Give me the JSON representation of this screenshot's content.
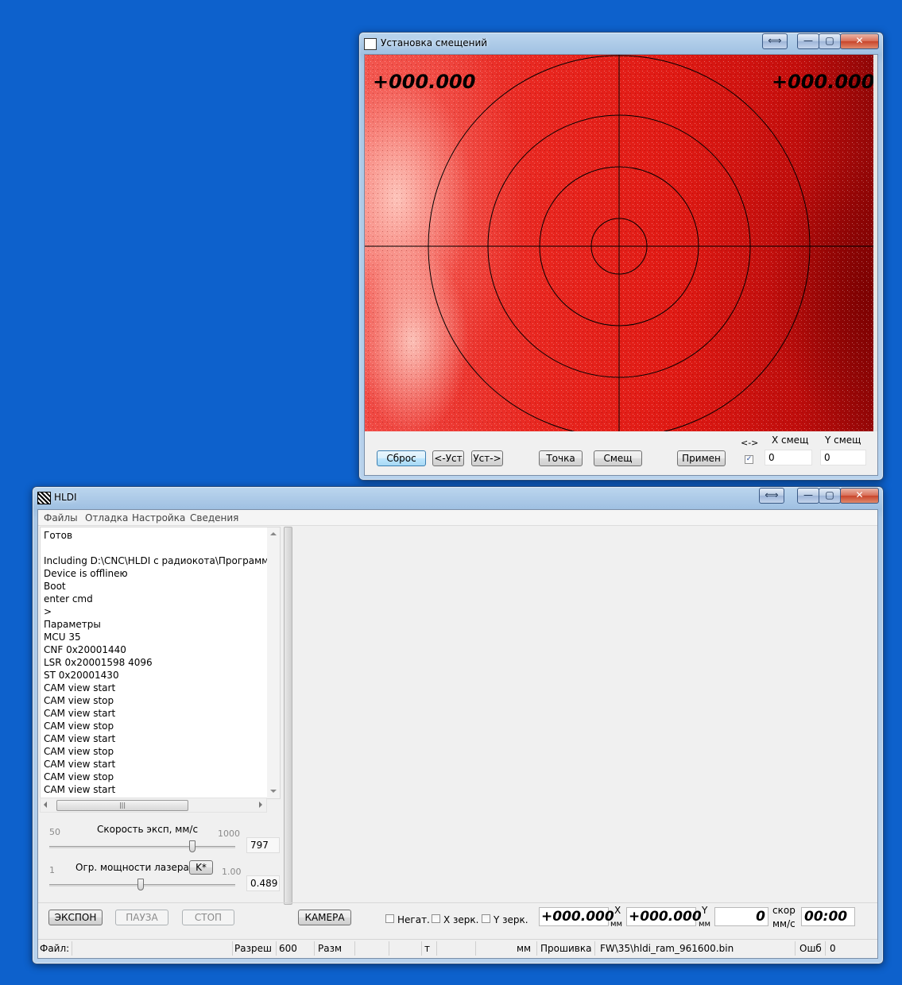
{
  "offsets_window": {
    "title": "Установка смещений",
    "coord_left": "+000.000",
    "coord_right": "+000.000",
    "buttons": {
      "reset": "Сброс",
      "set_left": "<-Уст",
      "set_right": "Уст->",
      "point": "Точка",
      "shift": "Смещ",
      "apply": "Примен"
    },
    "swap_label": "<->",
    "x_offset_label": "X смещ",
    "y_offset_label": "Y смещ",
    "x_offset_value": "0",
    "y_offset_value": "0",
    "swap_checked": true,
    "title_buttons": {
      "resize": "⟺",
      "minimize": "—",
      "maximize": "▢",
      "close": "✕"
    }
  },
  "main_window": {
    "title": "HLDI",
    "title_buttons": {
      "resize": "⟺",
      "minimize": "—",
      "maximize": "▢",
      "close": "✕"
    },
    "menu": [
      "Файлы",
      "Отладка",
      "Настройка",
      "Сведения"
    ],
    "log": [
      "Готов",
      "",
      "Including D:\\CNC\\HLDI с радиокота\\Программа",
      "Device is offlineю",
      " Boot",
      "enter cmd",
      ">",
      "Параметры",
      "MCU 35",
      "CNF 0x20001440",
      "LSR 0x20001598 4096",
      " ST 0x20001430",
      "CAM view start",
      "CAM view stop",
      "CAM view start",
      "CAM view stop",
      "CAM view start",
      "CAM view stop",
      "CAM view start",
      "CAM view stop",
      "CAM view start"
    ],
    "speed": {
      "label": "Скорость эксп, мм/с",
      "min": "50",
      "max": "1000",
      "value": "797",
      "fraction": 0.78
    },
    "power": {
      "label": "Огр. мощности лазера,",
      "k_button": "K*",
      "min": "1",
      "max": "1.00",
      "value": "0.489",
      "fraction": 0.489
    },
    "buttons": {
      "expose": "ЭКСПОН",
      "pause": "ПАУЗА",
      "stop": "СТОП",
      "camera": "КАМЕРА"
    },
    "checks": {
      "negative": "Негат.",
      "x_mirror": "X зерк.",
      "y_mirror": "Y зерк."
    },
    "x_pos": "+000.000",
    "x_label": "X",
    "x_unit": "мм",
    "y_pos": "+000.000",
    "y_label": "Y",
    "y_unit": "мм",
    "speed_val": "0",
    "speed_label": "скор",
    "speed_unit": "мм/с",
    "time": "00:00",
    "status": {
      "file_label": "Файл:",
      "res_label": "Разреш",
      "res_value": "600",
      "size_label": "Разм",
      "t_label": "т",
      "mm_label": "мм",
      "firmware_label": "Прошивка",
      "firmware_value": "FW\\35\\hldi_ram_961600.bin",
      "err_label": "Ошб",
      "err_value": "0"
    }
  }
}
